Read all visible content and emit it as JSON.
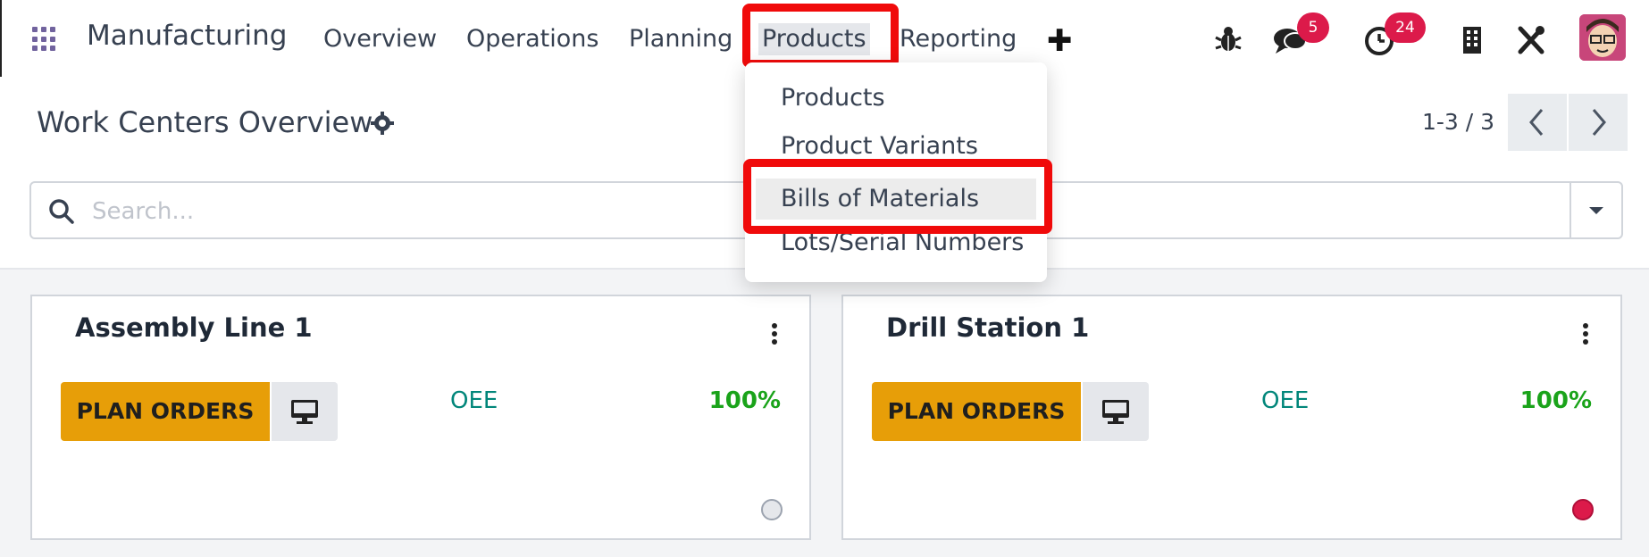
{
  "navbar": {
    "brand": "Manufacturing",
    "items": [
      "Overview",
      "Operations",
      "Planning",
      "Products",
      "Reporting"
    ],
    "active": "Products",
    "messages_badge": "5",
    "activities_badge": "24"
  },
  "dropdown": {
    "items": [
      "Products",
      "Product Variants",
      "Bills of Materials",
      "Lots/Serial Numbers"
    ],
    "highlighted": "Bills of Materials"
  },
  "control_panel": {
    "title": "Work Centers Overview",
    "pager": "1-3 / 3",
    "search_placeholder": "Search..."
  },
  "cards": [
    {
      "title": "Assembly Line 1",
      "button": "PLAN ORDERS",
      "oee_label": "OEE",
      "oee_value": "100%",
      "status": "grey"
    },
    {
      "title": "Drill Station 1",
      "button": "PLAN ORDERS",
      "oee_label": "OEE",
      "oee_value": "100%",
      "status": "red"
    }
  ],
  "colors": {
    "accent": "#71639e",
    "highlight": "#f00a0a",
    "plan_button": "#e79e08",
    "oee_label": "#01867a",
    "oee_value": "#1aa31a",
    "badge": "#dc1a4a",
    "status_red": "#dc1a4a",
    "status_grey": "#e5e7eb"
  }
}
